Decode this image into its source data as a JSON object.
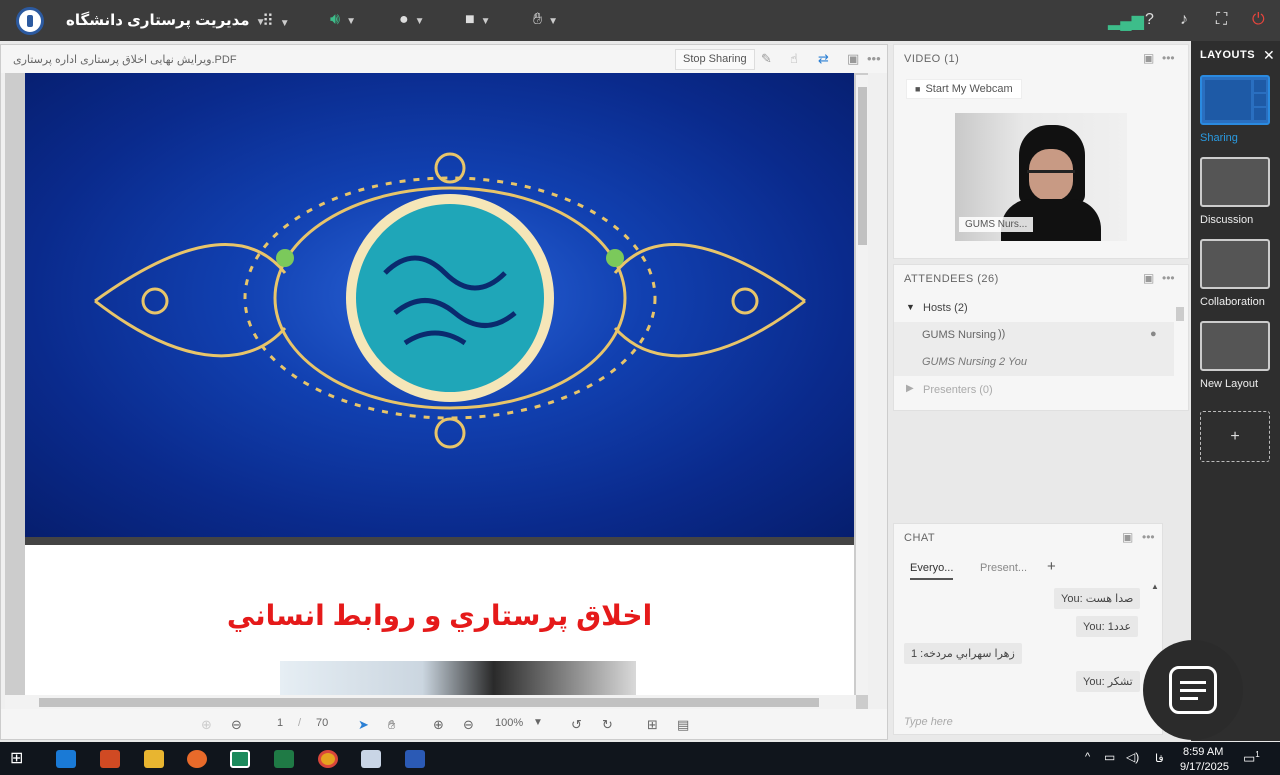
{
  "topbar": {
    "meeting_title": "مدیریت پرستاری دانشگاه",
    "apps_icon": "grid-icon",
    "audio_icon": "speaker-icon",
    "mic_icon": "mic-icon",
    "camera_icon": "camera-icon",
    "raise_hand_icon": "hand-icon",
    "right_icons": [
      "signal-icon",
      "help-icon",
      "bell-icon",
      "fullscreen-icon",
      "power-icon"
    ],
    "accent": "#3dbd8a",
    "power_color": "#e8453c"
  },
  "share": {
    "doc_name": "ویرایش نهایی اخلاق پرستاری اداره پرستاری.PDF",
    "stop_sharing_label": "Stop Sharing",
    "slide2_title": "اخلاق پرستاري و روابط انساني",
    "page_current": "1",
    "page_sep": "/",
    "page_total": "70",
    "zoom": "100%"
  },
  "video": {
    "title": "VIDEO",
    "count": "(1)",
    "start_webcam_label": "Start My Webcam",
    "participant_label": "GUMS Nurs..."
  },
  "attendees": {
    "title": "ATTENDEES",
    "count": "(26)",
    "hosts_label": "Hosts (2)",
    "members": [
      {
        "name": "GUMS Nursing"
      },
      {
        "name": "GUMS Nursing 2 You"
      }
    ],
    "presenters_label": "Presenters (0)"
  },
  "chat": {
    "title": "CHAT",
    "tabs": [
      "Everyo...",
      "Present..."
    ],
    "add_tab_label": "+",
    "messages": [
      {
        "text": "You: صدا هست"
      },
      {
        "text": "You: عدد1"
      },
      {
        "text": "زهرا سهرابي مردخه: 1"
      },
      {
        "text": "You: تشکر"
      }
    ],
    "input_placeholder": "Type here"
  },
  "layouts": {
    "title": "LAYOUTS",
    "items": [
      {
        "label": "Sharing",
        "active": true
      },
      {
        "label": "Discussion"
      },
      {
        "label": "Collaboration"
      },
      {
        "label": "New Layout"
      }
    ],
    "add_label": "+"
  },
  "taskbar": {
    "apps": [
      "windows-icon",
      "edge-icon",
      "powerpoint-icon",
      "explorer-icon",
      "firefox-icon",
      "adobe-connect-icon",
      "excel-icon",
      "chrome-icon",
      "paint-icon",
      "word-icon"
    ],
    "lang": "فا",
    "time": "8:59 AM",
    "date": "9/17/2025",
    "notification_count": "1"
  }
}
